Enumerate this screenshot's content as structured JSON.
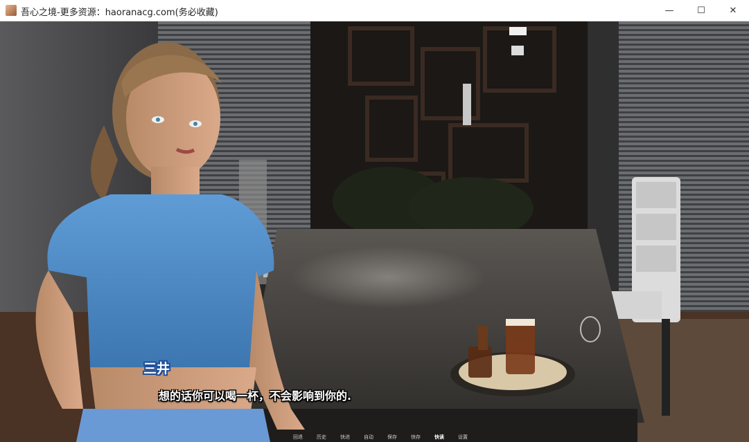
{
  "window": {
    "title": "吾心之境-更多资源：haoranacg.com(务必收藏)",
    "minimize": "—",
    "maximize": "☐",
    "close": "✕"
  },
  "dialogue": {
    "speaker": "三井",
    "text": "想的话你可以喝一杯，不会影响到你的."
  },
  "quick_menu": {
    "items": [
      "回退",
      "历史",
      "快进",
      "自动",
      "保存",
      "快存",
      "快读",
      "设置"
    ]
  },
  "colors": {
    "speaker_outline": "#1f4f9a",
    "text_color": "#ffffff"
  }
}
